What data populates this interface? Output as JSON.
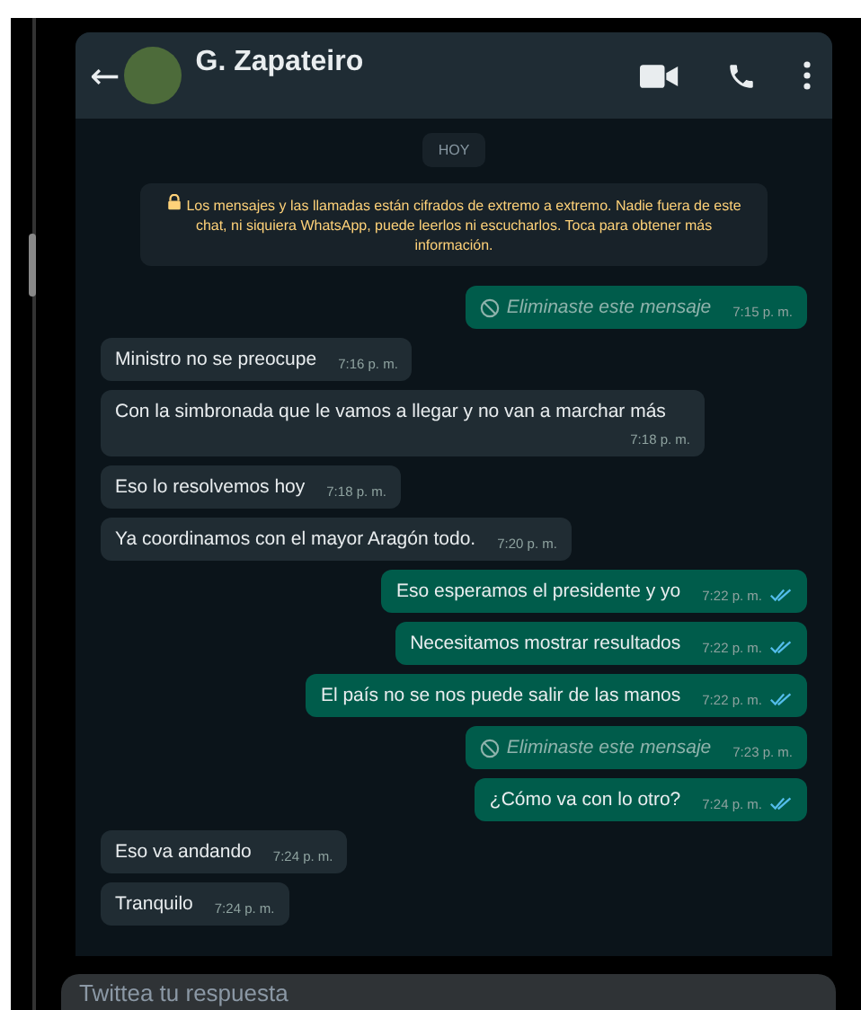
{
  "chat_header": {
    "back": "←",
    "contact_name": "G. Zapateiro"
  },
  "date_chip": "HOY",
  "encryption_notice": "Los mensajes y las llamadas están cifrados de extremo a extremo. Nadie fuera de este chat, ni siquiera WhatsApp, puede leerlos ni escucharlos. Toca para obtener más información.",
  "messages": [
    {
      "kind": "deleted",
      "outgoing": true,
      "text": "Eliminaste este mensaje",
      "time": "7:15 p. m.",
      "read": false
    },
    {
      "kind": "text",
      "outgoing": false,
      "text": "Ministro no se preocupe",
      "time": "7:16 p. m.",
      "read": false
    },
    {
      "kind": "text",
      "outgoing": false,
      "text": "Con la simbronada que le vamos a llegar y no van a marchar más",
      "time": "7:18 p. m.",
      "read": false
    },
    {
      "kind": "text",
      "outgoing": false,
      "text": "Eso lo resolvemos hoy",
      "time": "7:18 p. m.",
      "read": false
    },
    {
      "kind": "text",
      "outgoing": false,
      "text": "Ya coordinamos con el mayor Aragón todo.",
      "time": "7:20 p. m.",
      "read": false
    },
    {
      "kind": "text",
      "outgoing": true,
      "text": "Eso esperamos el presidente y yo",
      "time": "7:22 p. m.",
      "read": true
    },
    {
      "kind": "text",
      "outgoing": true,
      "text": "Necesitamos mostrar resultados",
      "time": "7:22 p. m.",
      "read": true
    },
    {
      "kind": "text",
      "outgoing": true,
      "text": "El país no se nos puede salir de las manos",
      "time": "7:22 p. m.",
      "read": true
    },
    {
      "kind": "deleted",
      "outgoing": true,
      "text": "Eliminaste este mensaje",
      "time": "7:23 p. m.",
      "read": false
    },
    {
      "kind": "text",
      "outgoing": true,
      "text": "¿Cómo va con lo otro?",
      "time": "7:24 p. m.",
      "read": true
    },
    {
      "kind": "text",
      "outgoing": false,
      "text": "Eso va andando",
      "time": "7:24 p. m.",
      "read": false
    },
    {
      "kind": "text",
      "outgoing": false,
      "text": "Tranquilo",
      "time": "7:24 p. m.",
      "read": false
    }
  ],
  "reply_field": {
    "placeholder": "Twittea tu respuesta"
  }
}
